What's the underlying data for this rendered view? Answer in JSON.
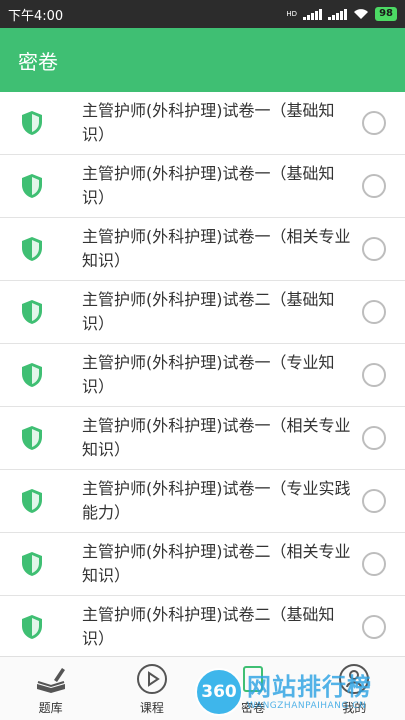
{
  "status_bar": {
    "time": "下午4:00",
    "hd": "HD",
    "battery": "98"
  },
  "app_bar": {
    "title": "密卷"
  },
  "papers": [
    {
      "title": "主管护师(外科护理)试卷一（基础知识）"
    },
    {
      "title": "主管护师(外科护理)试卷一（基础知识）"
    },
    {
      "title": "主管护师(外科护理)试卷一（相关专业知识）"
    },
    {
      "title": "主管护师(外科护理)试卷二（基础知识）"
    },
    {
      "title": "主管护师(外科护理)试卷一（专业知识）"
    },
    {
      "title": "主管护师(外科护理)试卷一（相关专业知识）"
    },
    {
      "title": "主管护师(外科护理)试卷一（专业实践能力）"
    },
    {
      "title": "主管护师(外科护理)试卷二（相关专业知识）"
    },
    {
      "title": "主管护师(外科护理)试卷二（基础知识）"
    }
  ],
  "tabs": [
    {
      "label": "题库",
      "icon": "book-pen-icon"
    },
    {
      "label": "课程",
      "icon": "play-circle-icon"
    },
    {
      "label": "密卷",
      "icon": "lock-paper-icon"
    },
    {
      "label": "我的",
      "icon": "person-icon"
    }
  ],
  "watermark": {
    "logo": "360",
    "main": "网站排行榜",
    "sub": "WANGZHANPAIHANG.CN"
  },
  "colors": {
    "accent": "#3fbf73",
    "status_bar": "#2c2c2c"
  }
}
